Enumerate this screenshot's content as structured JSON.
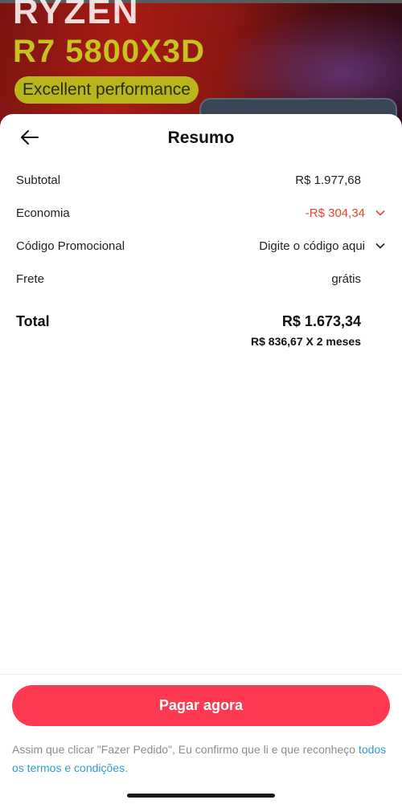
{
  "banner": {
    "brand": "RYZEN",
    "model": "R7 5800X3D",
    "tagline": "Excellent performance"
  },
  "header": {
    "title": "Resumo",
    "back_icon": "arrow-left-icon"
  },
  "summary": {
    "subtotal": {
      "label": "Subtotal",
      "value": "R$ 1.977,68"
    },
    "savings": {
      "label": "Economia",
      "value": "-R$ 304,34",
      "color": "#e2482f"
    },
    "promo": {
      "label": "Código Promocional",
      "value": "Digite o código aqui"
    },
    "shipping": {
      "label": "Frete",
      "value": "grátis"
    }
  },
  "total": {
    "label": "Total",
    "value": "R$ 1.673,34",
    "installment": "R$ 836,67 X 2 meses"
  },
  "footer": {
    "pay_label": "Pagar agora",
    "pay_color": "#fe3a52",
    "terms_text": "Assim que clicar \"Fazer Pedido\", Eu confirmo que li e que reconheço ",
    "terms_link": "todos os termos e condições",
    "terms_end": "."
  }
}
